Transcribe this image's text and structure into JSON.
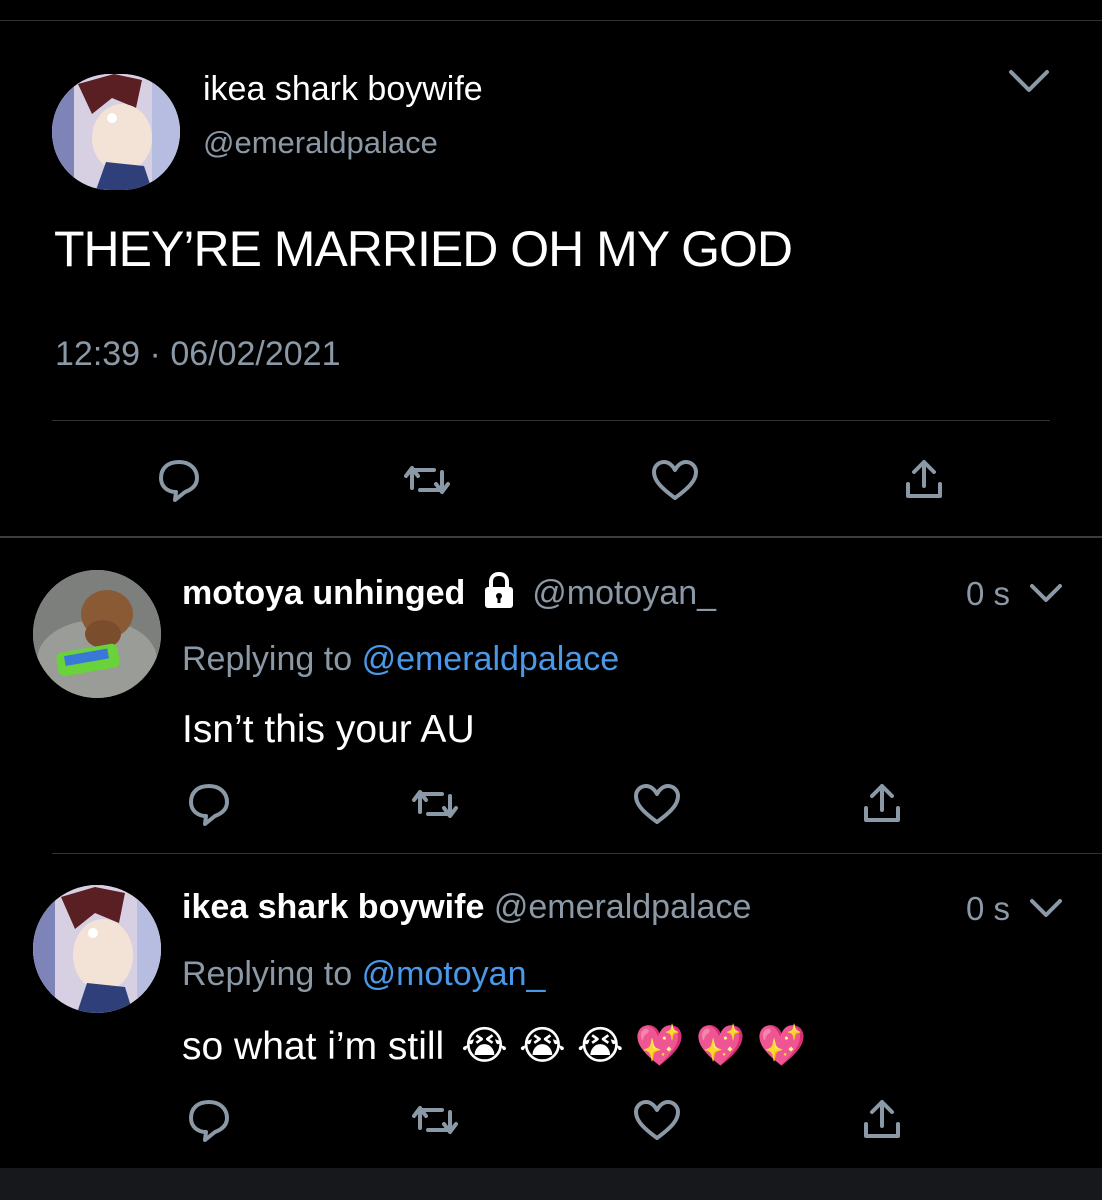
{
  "main_tweet": {
    "display_name": "ikea shark boywife",
    "handle": "@emeraldpalace",
    "text": "THEY’RE MARRIED OH MY GOD",
    "time": "12:39",
    "separator": "·",
    "date": "06/02/2021"
  },
  "replies": [
    {
      "display_name": "motoya unhinged",
      "handle": "@motoyan_",
      "protected_icon": "lock-icon",
      "age": "0 s",
      "replying_prefix": "Replying to",
      "replying_to": "@emeraldpalace",
      "text": "Isn’t this your AU"
    },
    {
      "display_name": "ikea shark boywife",
      "handle": "@emeraldpalace",
      "age": "0 s",
      "replying_prefix": "Replying to",
      "replying_to": "@motoyan_",
      "text": "so what i’m still",
      "emoji": [
        "😭",
        "😭",
        "😭",
        "💖",
        "💖",
        "💖"
      ]
    }
  ],
  "icons": [
    "chevron-down-icon",
    "reply-icon",
    "retweet-icon",
    "like-icon",
    "share-icon"
  ],
  "colors": {
    "background": "#000000",
    "link": "#4a99e9",
    "muted": "#8b98a5",
    "divider": "#2f3336"
  }
}
